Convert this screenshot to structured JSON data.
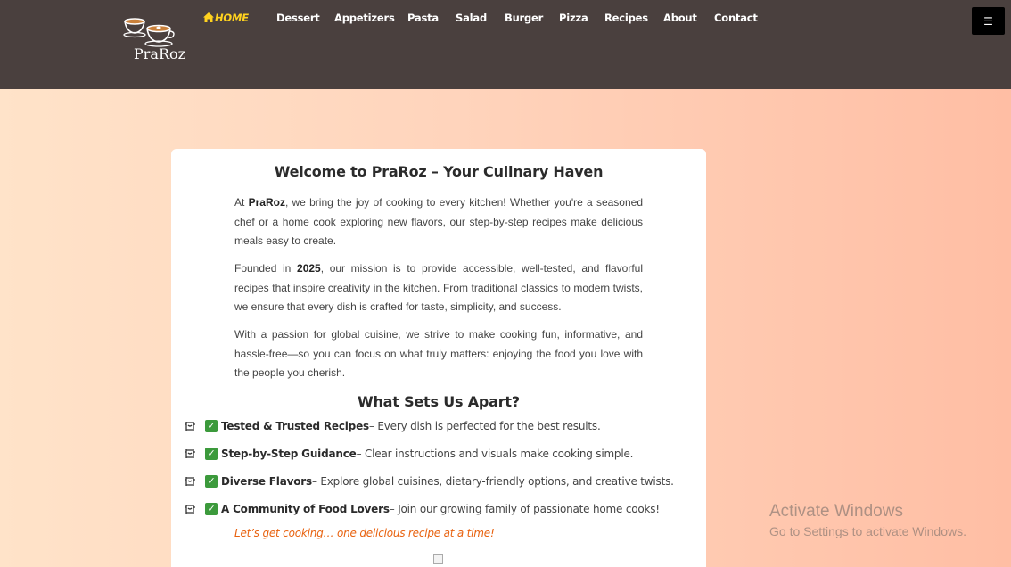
{
  "brand": {
    "name": "PraRoz"
  },
  "nav": {
    "items": [
      "HOME",
      "Dessert",
      "Appetizers",
      "Pasta",
      "Salad",
      "Burger",
      "Pizza",
      "Recipes",
      "About",
      "Contact"
    ],
    "menu_icon": "☰",
    "accent": "#ffd21f"
  },
  "intro": {
    "title": "Welcome to PraRoz – Your Culinary Haven",
    "p1": {
      "pre": "At ",
      "bold": "PraRoz",
      "post": ", we bring the joy of cooking to every kitchen! Whether you're a seasoned chef or a home cook exploring new flavors, our step-by-step recipes make delicious meals easy to create."
    },
    "p2": {
      "pre": "Founded in ",
      "bold": "2025",
      "post": ", our mission is to provide accessible, well-tested, and flavorful recipes that inspire creativity in the kitchen. From traditional classics to modern twists, we ensure that every dish is crafted for taste, simplicity, and success."
    },
    "p3": "With a passion for global cuisine, we strive to make cooking fun, informative, and hassle-free—so you can focus on what truly matters: enjoying the food you love with the people you cherish."
  },
  "apart": {
    "title": "What Sets Us Apart?",
    "features": [
      {
        "bold": "Tested & Trusted Recipes",
        "text": "– Every dish is perfected for the best results."
      },
      {
        "bold": "Step-by-Step Guidance",
        "text": "– Clear instructions and visuals make cooking simple."
      },
      {
        "bold": "Diverse Flavors",
        "text": "– Explore global cuisines, dietary-friendly options, and creative twists."
      },
      {
        "bold": "A Community of Food Lovers",
        "text": "– Join our growing family of passionate home cooks!"
      }
    ],
    "tagline": "Let’s get cooking… one delicious recipe at a time!"
  },
  "watermark": {
    "title": "Activate Windows",
    "subtitle": "Go to Settings to activate Windows."
  },
  "colors": {
    "header_bg": "#4a403e",
    "tagline": "#e8620f",
    "check": "#3c9a3c"
  }
}
